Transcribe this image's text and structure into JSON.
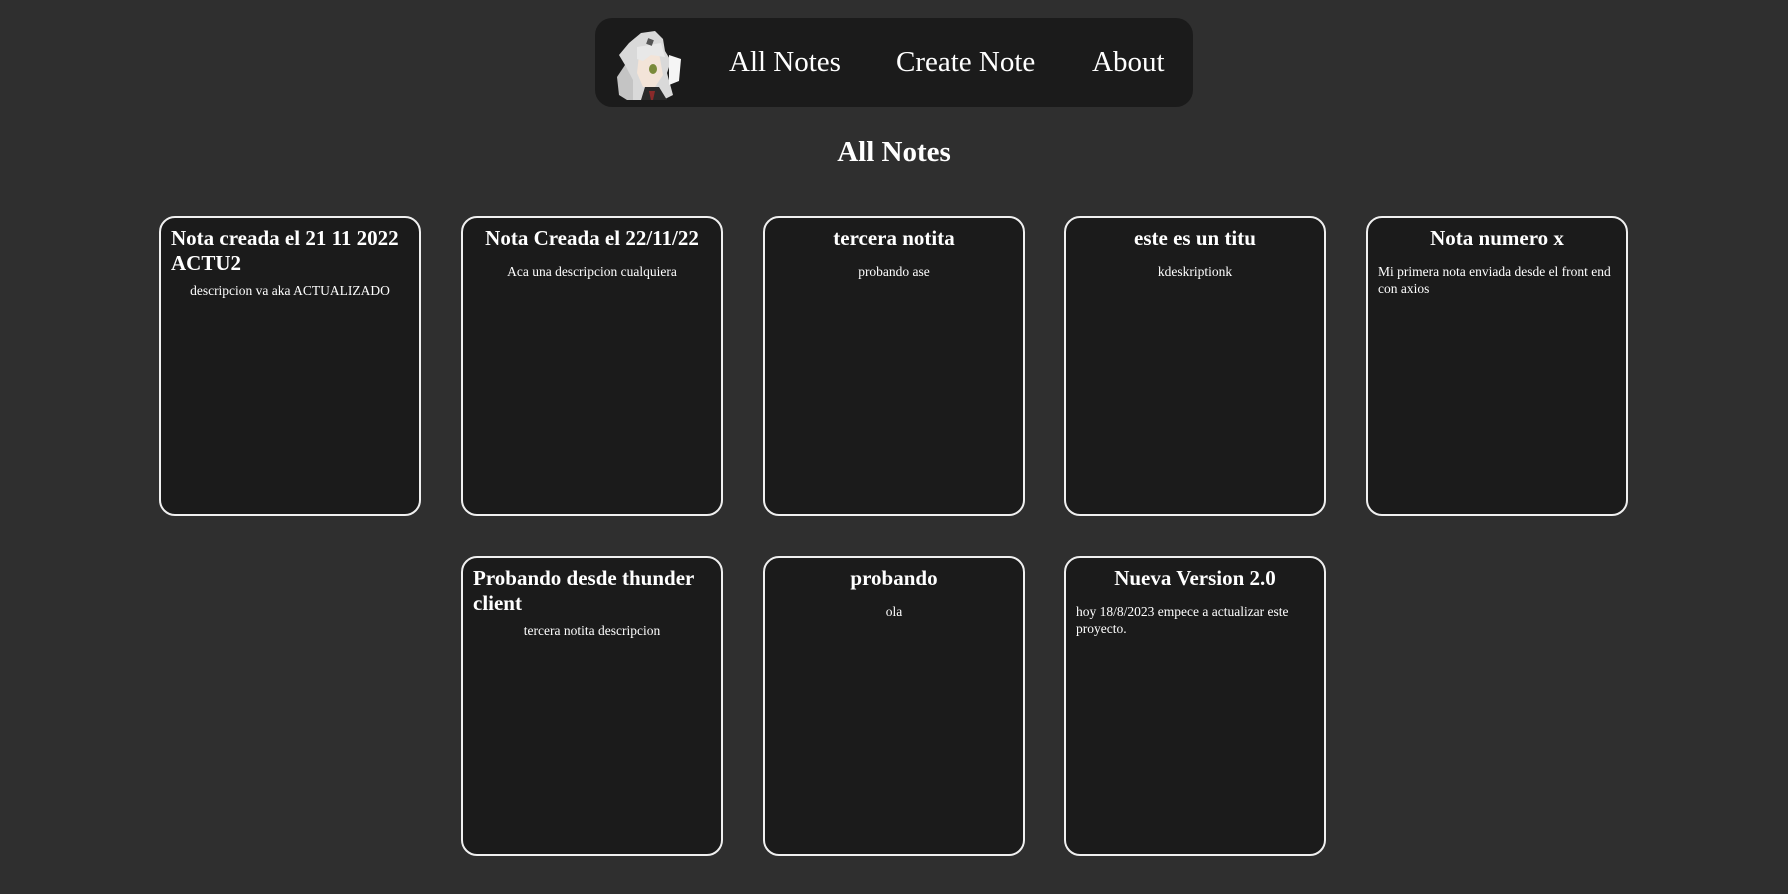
{
  "nav": {
    "links": [
      {
        "label": "All Notes"
      },
      {
        "label": "Create Note"
      },
      {
        "label": "About"
      }
    ]
  },
  "page": {
    "title": "All Notes"
  },
  "notes": [
    {
      "title": "Nota creada el 21 11 2022 ACTU2",
      "description": "descripcion va aka ACTUALIZADO"
    },
    {
      "title": "Nota Creada el 22/11/22",
      "description": "Aca una descripcion cualquiera"
    },
    {
      "title": "tercera notita",
      "description": "probando ase"
    },
    {
      "title": "este es un titu",
      "description": "kdeskriptionk"
    },
    {
      "title": "Nota numero x",
      "description": "Mi primera nota enviada desde el front end con axios"
    },
    {
      "title": "Probando desde thunder client",
      "description": "tercera notita descripcion"
    },
    {
      "title": "probando",
      "description": "ola"
    },
    {
      "title": "Nueva Version 2.0",
      "description": "hoy 18/8/2023 empece a actualizar este proyecto."
    }
  ],
  "colors": {
    "background": "#2f2f2f",
    "surface": "#1b1b1b",
    "border": "#f0f0f0",
    "text": "#ffffff"
  },
  "icons": {
    "logo": "anime-avatar-logo"
  }
}
